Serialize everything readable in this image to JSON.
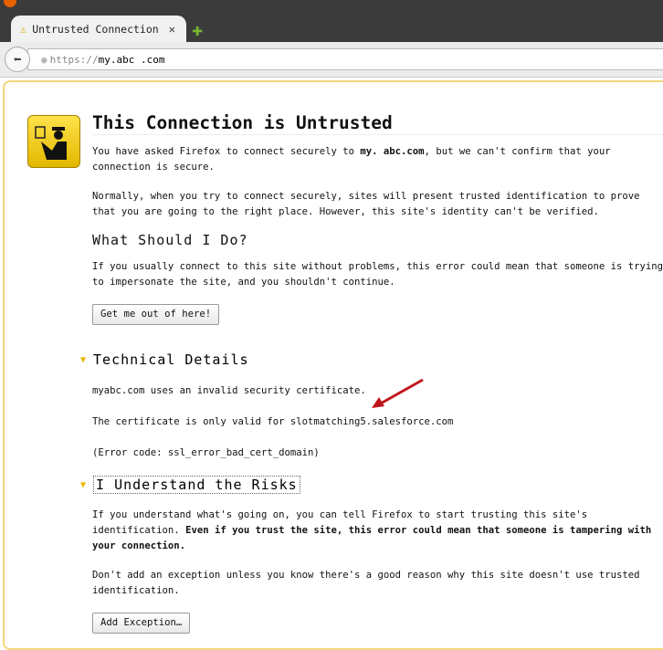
{
  "browser": {
    "tab_title": "Untrusted Connection",
    "url_scheme": "https://",
    "url_host": "my.abc .com"
  },
  "page": {
    "title": "This Connection is Untrusted",
    "intro_1a": "You have asked Firefox to connect securely to ",
    "intro_host": "my. abc.com",
    "intro_1b": ", but we can't confirm that your connection is secure.",
    "intro_2": "Normally, when you try to connect securely, sites will present trusted identification to prove that you are going to the right place. However, this site's identity can't be verified.",
    "what_heading": "What Should I Do?",
    "what_text": "If you usually connect to this site without problems, this error could mean that someone is trying to impersonate the site, and you shouldn't continue.",
    "get_out_button": "Get me out of here!",
    "tech_heading": "Technical Details",
    "tech_1": "myabc.com uses an invalid security certificate.",
    "tech_2": "The certificate is only valid for slotmatching5.salesforce.com",
    "tech_3": "(Error code: ssl_error_bad_cert_domain)",
    "risks_heading": "I Understand the Risks",
    "risks_1a": "If you understand what's going on, you can tell Firefox to start trusting this site's identification. ",
    "risks_1b": "Even if you trust the site, this error could mean that someone is tampering with your connection.",
    "risks_2": "Don't add an exception unless you know there's a good reason why this site doesn't use trusted identification.",
    "add_exception_button": "Add Exception…"
  }
}
